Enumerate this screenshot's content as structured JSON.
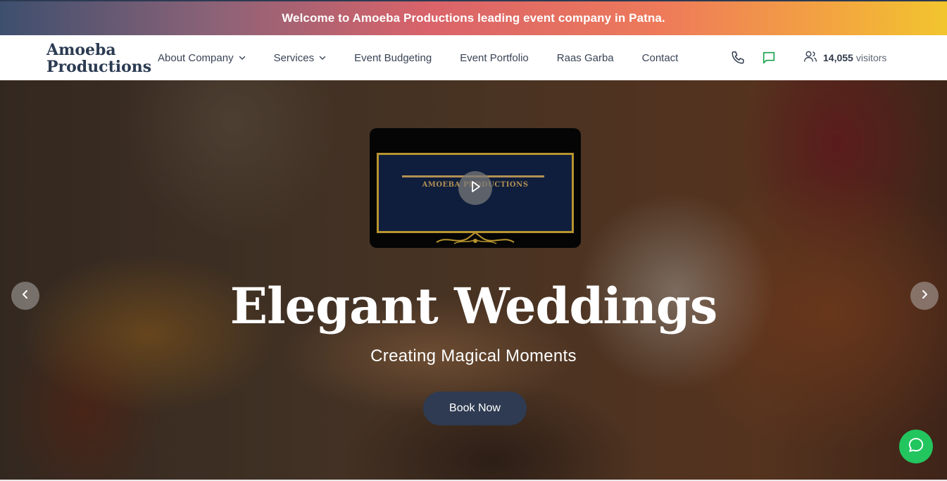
{
  "banner": {
    "text": "Welcome to Amoeba Productions leading event company in Patna."
  },
  "logo": {
    "line1": "Amoeba",
    "line2": "Productions"
  },
  "nav": {
    "items": [
      {
        "label": "About Company",
        "has_dropdown": true
      },
      {
        "label": "Services",
        "has_dropdown": true
      },
      {
        "label": "Event Budgeting",
        "has_dropdown": false
      },
      {
        "label": "Event Portfolio",
        "has_dropdown": false
      },
      {
        "label": "Raas Garba",
        "has_dropdown": false
      },
      {
        "label": "Contact",
        "has_dropdown": false
      }
    ],
    "phone_icon": "phone-icon",
    "message_icon": "message-icon",
    "visitors": {
      "icon": "users-icon",
      "count": "14,055",
      "label": "visitors"
    }
  },
  "hero": {
    "video": {
      "title": "AMOEBA PRODUCTIONS",
      "play_icon": "play-icon"
    },
    "title": "Elegant Weddings",
    "subtitle": "Creating Magical Moments",
    "cta_label": "Book Now",
    "prev_icon": "chevron-left-icon",
    "next_icon": "chevron-right-icon"
  },
  "chat": {
    "icon": "chat-bubble-icon"
  },
  "colors": {
    "brand_dark": "#2e3b52",
    "chat_green": "#22c55e",
    "message_icon_green": "#16a34a",
    "gold": "#b8942e"
  }
}
